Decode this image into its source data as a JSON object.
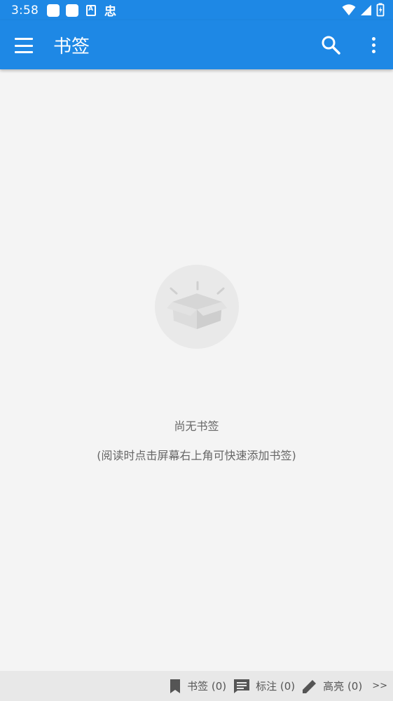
{
  "status_bar": {
    "time": "3:58",
    "app_glyph": "忠"
  },
  "app_bar": {
    "title": "书签"
  },
  "empty_state": {
    "title": "尚无书签",
    "hint": "(阅读时点击屏幕右上角可快速添加书签)"
  },
  "bottom_tabs": [
    {
      "label": "书签 (0)",
      "icon": "bookmark-icon"
    },
    {
      "label": "标注 (0)",
      "icon": "comment-icon"
    },
    {
      "label": "高亮 (0)",
      "icon": "pencil-icon"
    }
  ],
  "more_tabs_label": ">>",
  "colors": {
    "primary": "#1e88e5",
    "background": "#f4f4f4",
    "bottom_bar": "#e8e8e8",
    "text_secondary": "#666666"
  }
}
